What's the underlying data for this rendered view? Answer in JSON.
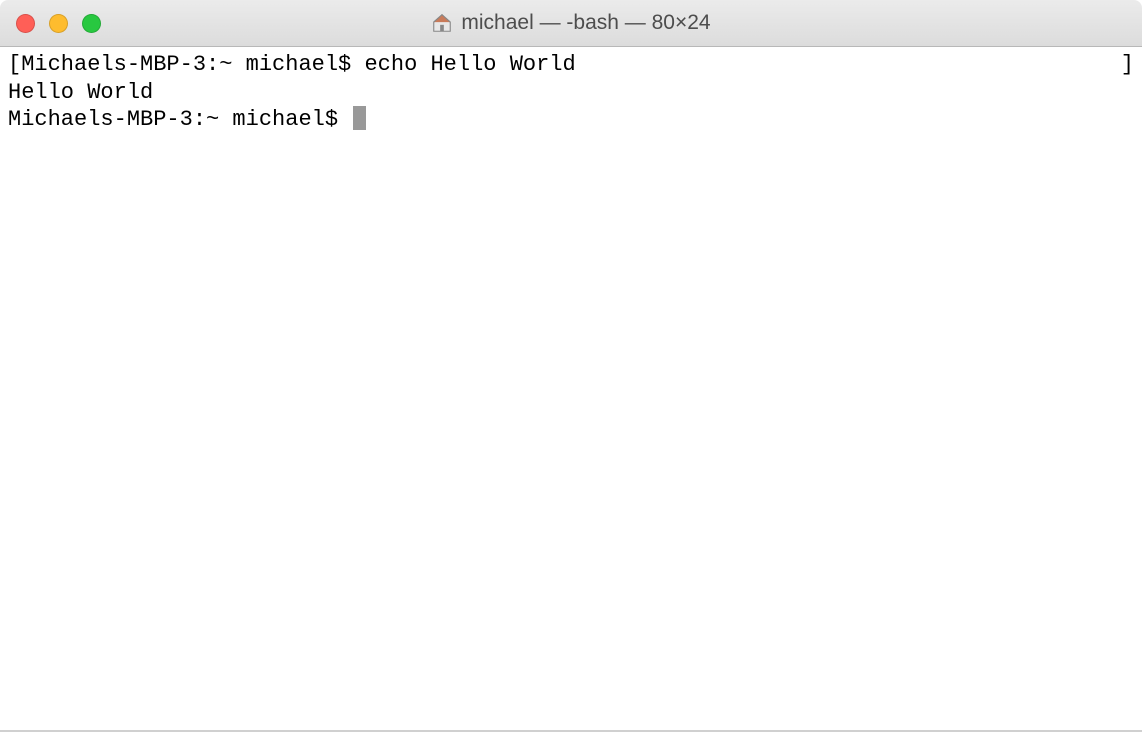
{
  "title_bar": {
    "window_title": "michael — -bash — 80×24"
  },
  "terminal": {
    "lines": [
      {
        "prefix": "[",
        "prompt": "Michaels-MBP-3:~ michael$ ",
        "command": "echo Hello World",
        "suffix": "]"
      },
      {
        "output": "Hello World"
      },
      {
        "prompt": "Michaels-MBP-3:~ michael$ ",
        "has_cursor": true
      }
    ]
  }
}
